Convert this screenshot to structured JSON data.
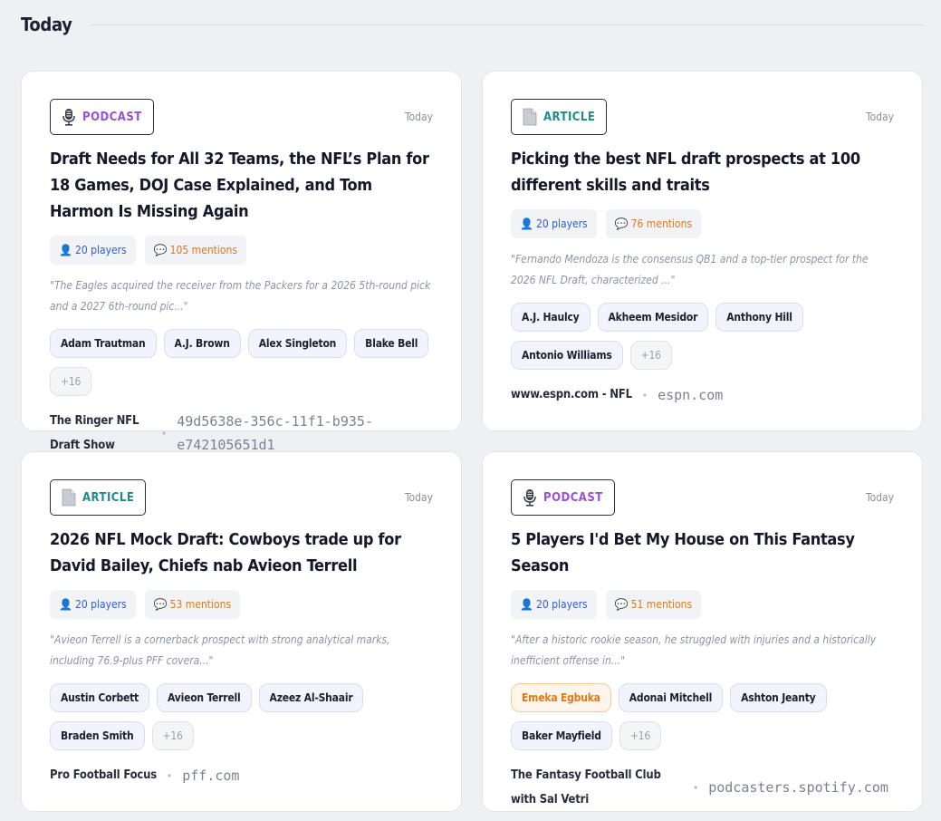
{
  "section": {
    "title": "Today"
  },
  "cards": [
    {
      "type_label": "PODCAST",
      "type_icon": "microphone-icon",
      "date": "Today",
      "title": "Draft Needs for All 32 Teams, the NFL’s Plan for 18 Games, DOJ Case Explained, and Tom Harmon Is Missing Again",
      "players": "20 players",
      "mentions": "105 mentions",
      "quote": "\"The Eagles acquired the receiver from the Packers for a 2026 5th-round pick and a 2027 6th-round pic...\"",
      "tags": [
        "Adam Trautman",
        "A.J. Brown",
        "Alex Singleton",
        "Blake Bell"
      ],
      "more": "+16",
      "source_name": "The Ringer NFL Draft Show",
      "source_domain": "49d5638e-356c-11f1-b935-e742105651d1"
    },
    {
      "type_label": "ARTICLE",
      "type_icon": "document-icon",
      "date": "Today",
      "title": "Picking the best NFL draft prospects at 100 different skills and traits",
      "players": "20 players",
      "mentions": "76 mentions",
      "quote": "\"Fernando Mendoza is the consensus QB1 and a top-tier prospect for the 2026 NFL Draft, characterized ...\"",
      "tags": [
        "A.J. Haulcy",
        "Akheem Mesidor",
        "Anthony Hill",
        "Antonio Williams"
      ],
      "more": "+16",
      "source_name": "www.espn.com - NFL",
      "source_domain": "espn.com"
    },
    {
      "type_label": "ARTICLE",
      "type_icon": "document-icon",
      "date": "Today",
      "title": "2026 NFL Mock Draft: Cowboys trade up for David Bailey, Chiefs nab Avieon Terrell",
      "players": "20 players",
      "mentions": "53 mentions",
      "quote": "\"Avieon Terrell is a cornerback prospect with strong analytical marks, including 76.9-plus PFF covera...\"",
      "tags": [
        "Austin Corbett",
        "Avieon Terrell",
        "Azeez Al-Shaair",
        "Braden Smith"
      ],
      "more": "+16",
      "source_name": "Pro Football Focus",
      "source_domain": "pff.com"
    },
    {
      "type_label": "PODCAST",
      "type_icon": "microphone-icon",
      "date": "Today",
      "title": "5 Players I'd Bet My House on This Fantasy Season",
      "players": "20 players",
      "mentions": "51 mentions",
      "quote": "\"After a historic rookie season, he struggled with injuries and a historically inefficient offense in...\"",
      "highlight_tag": "Emeka Egbuka",
      "tags": [
        "Adonai Mitchell",
        "Ashton Jeanty",
        "Baker Mayfield"
      ],
      "more": "+16",
      "source_name": "The Fantasy Football Club with Sal Vetri",
      "source_domain": "podcasters.spotify.com"
    }
  ]
}
